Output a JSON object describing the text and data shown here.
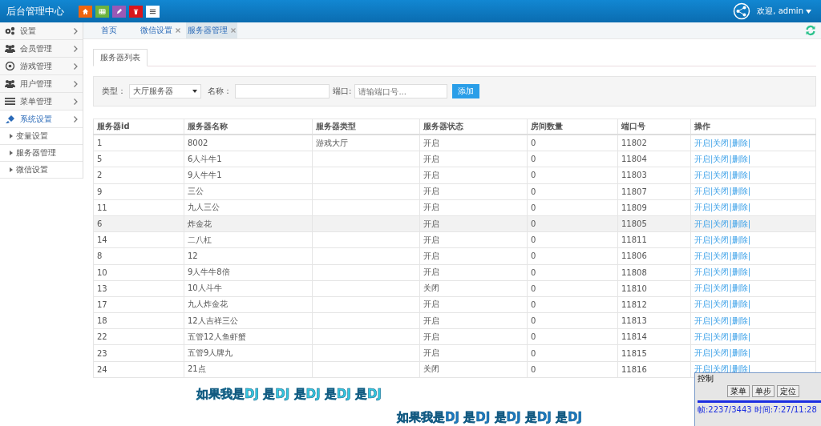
{
  "header": {
    "title": "后台管理中心",
    "user": "欢迎, admin"
  },
  "toolbar": [
    {
      "kind": "home",
      "color": "#f0650e"
    },
    {
      "kind": "grid",
      "color": "#6db33f"
    },
    {
      "kind": "pencil",
      "color": "#9b59b6"
    },
    {
      "kind": "trash",
      "color": "#d9161c"
    },
    {
      "kind": "list",
      "color": "#ffffff"
    }
  ],
  "sidebar": {
    "items": [
      {
        "label": "设置",
        "selected": false
      },
      {
        "label": "会员管理",
        "selected": false
      },
      {
        "label": "游戏管理",
        "selected": false
      },
      {
        "label": "用户管理",
        "selected": false
      },
      {
        "label": "菜单管理",
        "selected": false
      },
      {
        "label": "系统设置",
        "selected": true,
        "children": [
          {
            "label": "变量设置"
          },
          {
            "label": "服务器管理"
          },
          {
            "label": "微信设置"
          }
        ]
      }
    ]
  },
  "tabs": [
    {
      "label": "首页",
      "closable": false,
      "selected": false
    },
    {
      "label": "微信设置",
      "closable": true,
      "selected": false
    },
    {
      "label": "服务器管理",
      "closable": true,
      "selected": true
    }
  ],
  "panel_tab": "服务器列表",
  "filter": {
    "type_label": "类型：",
    "type_value": "大厅服务器",
    "name_label": "名称：",
    "port_label": "端口:",
    "port_placeholder": "请输端口号...",
    "add_button": "添加"
  },
  "table": {
    "columns": [
      "服务器id",
      "服务器名称",
      "服务器类型",
      "服务器状态",
      "房间数量",
      "端口号",
      "操作"
    ],
    "rows": [
      {
        "id": "1",
        "name": "8002",
        "type": "游戏大厅",
        "status": "开启",
        "rooms": "0",
        "port": "11802",
        "actions": [
          "开启|",
          "关闭|",
          "删除|"
        ],
        "highlighted": false
      },
      {
        "id": "5",
        "name": "6人斗牛1",
        "status": "开启",
        "rooms": "0",
        "port": "11804",
        "actions": [
          "开启|",
          "关闭|",
          "删除|"
        ],
        "highlighted": false
      },
      {
        "id": "2",
        "name": "9人牛牛1",
        "status": "开启",
        "rooms": "0",
        "port": "11803",
        "actions": [
          "开启|",
          "关闭|",
          "删除|"
        ],
        "highlighted": false
      },
      {
        "id": "9",
        "name": "三公",
        "status": "开启",
        "rooms": "0",
        "port": "11807",
        "actions": [
          "开启|",
          "关闭|",
          "删除|"
        ],
        "highlighted": false
      },
      {
        "id": "11",
        "name": "九人三公",
        "status": "开启",
        "rooms": "0",
        "port": "11809",
        "actions": [
          "开启|",
          "关闭|",
          "删除|"
        ],
        "highlighted": false
      },
      {
        "id": "6",
        "name": "炸金花",
        "status": "开启",
        "rooms": "0",
        "port": "11805",
        "actions": [
          "开启|",
          "关闭|",
          "删除|"
        ],
        "highlighted": true
      },
      {
        "id": "14",
        "name": "二八杠",
        "status": "开启",
        "rooms": "0",
        "port": "11811",
        "actions": [
          "开启|",
          "关闭|",
          "删除|"
        ],
        "highlighted": false
      },
      {
        "id": "8",
        "name": "12",
        "status": "开启",
        "rooms": "0",
        "port": "11806",
        "actions": [
          "开启|",
          "关闭|",
          "删除|"
        ],
        "highlighted": false
      },
      {
        "id": "10",
        "name": "9人牛牛8倍",
        "status": "开启",
        "rooms": "0",
        "port": "11808",
        "actions": [
          "开启|",
          "关闭|",
          "删除|"
        ],
        "highlighted": false
      },
      {
        "id": "13",
        "name": "10人斗牛",
        "status": "关闭",
        "rooms": "0",
        "port": "11810",
        "actions": [
          "开启|",
          "关闭|",
          "删除|"
        ],
        "highlighted": false
      },
      {
        "id": "17",
        "name": "九人炸金花",
        "status": "开启",
        "rooms": "0",
        "port": "11812",
        "actions": [
          "开启|",
          "关闭|",
          "删除|"
        ],
        "highlighted": false
      },
      {
        "id": "18",
        "name": "12人吉祥三公",
        "status": "开启",
        "rooms": "0",
        "port": "11813",
        "actions": [
          "开启|",
          "关闭|",
          "删除|"
        ],
        "highlighted": false
      },
      {
        "id": "22",
        "name": "五管12人鱼虾蟹",
        "status": "开启",
        "rooms": "0",
        "port": "11814",
        "actions": [
          "开启|",
          "关闭|",
          "删除|"
        ],
        "highlighted": false
      },
      {
        "id": "23",
        "name": "五管9人牌九",
        "status": "开启",
        "rooms": "0",
        "port": "11815",
        "actions": [
          "开启|",
          "关闭|",
          "删除|"
        ],
        "highlighted": false
      },
      {
        "id": "24",
        "name": "21点",
        "status": "关闭",
        "rooms": "0",
        "port": "11816",
        "actions": [
          "开启|",
          "关闭|",
          "删除|"
        ],
        "highlighted": false
      }
    ]
  },
  "lyrics": [
    "如果我是DJ  是DJ  是DJ  是DJ  是DJ",
    "如果我是DJ  是DJ  是DJ  是DJ  是DJ"
  ],
  "recorder": {
    "title": "控制",
    "buttons": [
      "菜单",
      "单步",
      "定位"
    ],
    "status": "帧:2237/3443 时间:7:27/11:28"
  }
}
